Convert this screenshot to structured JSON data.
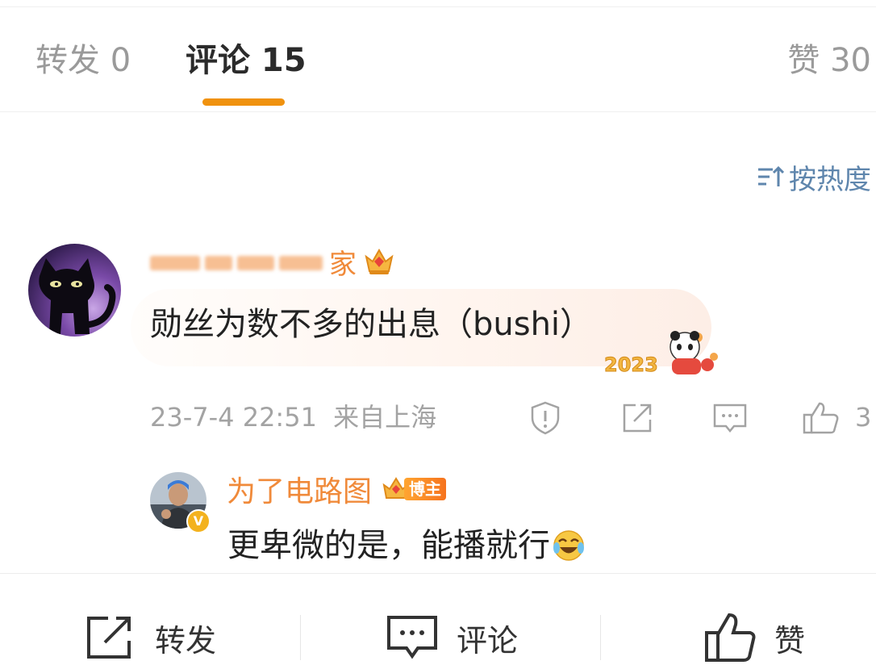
{
  "tabs": {
    "repost": "转发 0",
    "comments": "评论 15",
    "likes": "赞 30"
  },
  "sort": {
    "label": "按热度"
  },
  "comment": {
    "username_visible": "家",
    "text": "勋丝为数不多的出息（bushi）",
    "sticker_year": "2023",
    "time": "23-7-4 22:51",
    "location": "来自上海",
    "like_count": "3",
    "actions": [
      "report-icon",
      "share-icon",
      "reply-icon",
      "like-icon"
    ]
  },
  "reply": {
    "username": "为了电路图",
    "badge": "博主",
    "text": "更卑微的是，能播就行"
  },
  "bottom_bar": {
    "repost": "转发",
    "comment": "评论",
    "like": "赞"
  },
  "colors": {
    "accent_orange": "#f0920f",
    "username_orange": "#f08a3a",
    "sort_blue": "#5f86ad",
    "meta_gray": "#a3a3a3"
  }
}
